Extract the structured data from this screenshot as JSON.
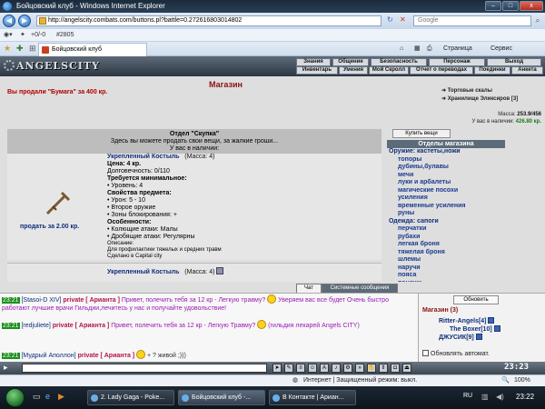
{
  "window": {
    "title": "Бойцовский клуб - Windows Internet Explorer",
    "controls": [
      "–",
      "□",
      "x"
    ]
  },
  "address": {
    "url": "http://angelscity.combats.com/buttons.pl?battle=0.272616803014802",
    "search_placeholder": "Google"
  },
  "toolbar": {
    "score": "+0/-0",
    "counter": "#2805"
  },
  "tabs": [
    {
      "label": "Бойцовский клуб"
    }
  ],
  "commands": {
    "page": "Страница",
    "tools": "Сервис"
  },
  "site": {
    "logo": "ANGELSCITY",
    "menu_top": [
      "Знания",
      "Общение",
      "Безопасность",
      "Персонаж",
      "Выход"
    ],
    "menu_bottom": [
      "Инвентарь",
      "Умения",
      "Мой Скролл",
      "Отчет о переводах",
      "Поединки",
      "Анкета"
    ]
  },
  "shop": {
    "title": "Магазин",
    "sold_message": "Вы продали \"Бумага\" за 400 кр.",
    "links": [
      "Торговые скалы",
      "Хранилище Эликсиров [3]"
    ],
    "mass_label": "Масса:",
    "mass_value": "253.9/456",
    "money_label": "У вас в наличии:",
    "money_value": "426.80 кр.",
    "dept_title": "Отдел \"Скупка\"",
    "dept_text": "Здесь вы можете продать свои вещи, за жалкие гроши...",
    "dept_have": "У вас в наличии:",
    "buy_button": "Купить вещи",
    "categories_title": "Отделы магазина",
    "categories": [
      {
        "group": "Оружие: кастеты,ножи",
        "items": [
          "топоры",
          "дубины,булавы",
          "мечи",
          "луки и арбалеты",
          "магические посохи",
          "усиления",
          "временные усиления",
          "руны"
        ]
      },
      {
        "group": "Одежда: сапоги",
        "items": [
          "перчатки",
          "рубахи",
          "легкая броня",
          "тяжелая броня",
          "шлемы",
          "наручи",
          "пояса",
          "поножи"
        ]
      }
    ]
  },
  "items": [
    {
      "name": "Укрепленный Костыль",
      "mass": "(Масса: 4)",
      "price": "Цена: 4 кр.",
      "durability": "Долговечность: 0/110",
      "req_title": "Требуется минимальное:",
      "req": [
        "• Уровень: 4"
      ],
      "props_title": "Свойства предмета:",
      "props": [
        "• Урон: 5 - 10",
        "• Второе оружие",
        "• Зоны блокирования: +"
      ],
      "features_title": "Особенности:",
      "features": [
        "• Колющие атаки: Малы",
        "• Дробящие атаки: Регулярны"
      ],
      "desc_title": "Описание:",
      "desc": "Для профилактики тяжелых и средних травм",
      "made": "Сделано в Capital city",
      "sell": "продать за 2.00 кр."
    },
    {
      "name": "Укрепленный Костыль",
      "mass": "(Масса: 4)"
    }
  ],
  "chat_tabs": {
    "chat": "Чат",
    "system": "Системные сообщения"
  },
  "chat": [
    {
      "time": "23:21",
      "nick": "[Stasoi-D XIV]",
      "priv": "private [ Арианта ]",
      "msg": "Привет, полечить тебя за 12 кр - Легкую травму?",
      "extra": "Уверяем вас все будет Очень быстро работают лучшие врачи Гильдии,лечитесь у нас и получайте удовольствие!"
    },
    {
      "time": "23:21",
      "nick": "[redjuliete]",
      "priv": "private [ Арианта ]",
      "msg": "Привет, полечить тебя за 12 кр - Легкую Травму?",
      "extra": "(гильдия лекарей Angels CITY)"
    },
    {
      "time": "23:21",
      "nick": "[Мудрый Аполлон]",
      "priv": "private [ Арианта ]",
      "msg": "+ ? живой ;)))"
    }
  ],
  "online": {
    "refresh": "Обновить",
    "title": "Магазин (3)",
    "users": [
      "Ritter-Angels[4]",
      "The Boxer[10]",
      "ДЖУСИК[9]"
    ],
    "auto": "Обновлять автомат."
  },
  "chat_clock": "23:23",
  "status": {
    "zone": "Интернет | Защищенный режим: выкл.",
    "zoom": "100%"
  },
  "taskbar": {
    "tasks": [
      "2. Lady Gaga - Poke...",
      "Бойцовский клуб -...",
      "В Контакте | Ариан..."
    ],
    "lang": "RU",
    "clock": "23:22"
  },
  "colors": {
    "header_dark": "#2d3743",
    "content_bg": "#dedede",
    "accent_red": "#8b1010",
    "link_blue": "#0f2e7a",
    "private_pink": "#b2144b",
    "msg_purple": "#9a1bb5"
  }
}
